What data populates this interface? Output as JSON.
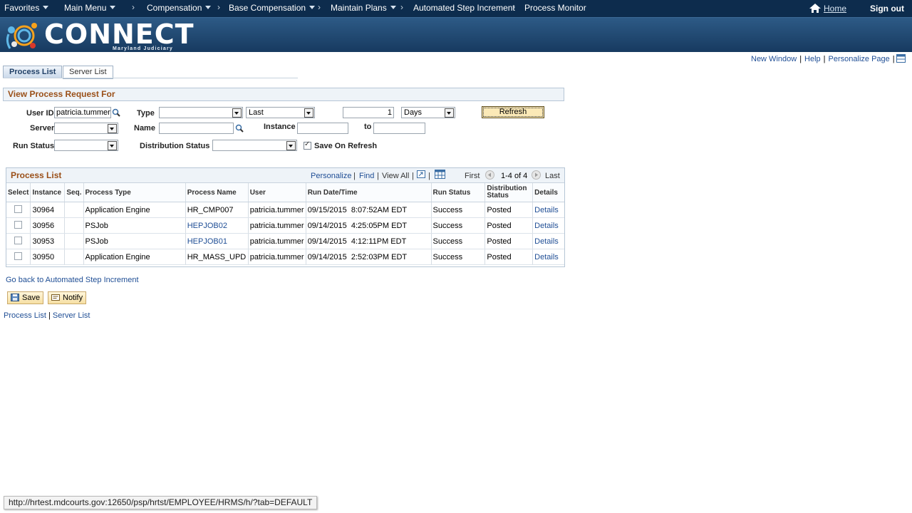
{
  "topnav": {
    "favorites": "Favorites",
    "main_menu": "Main Menu",
    "crumbs": [
      "Compensation",
      "Base Compensation",
      "Maintain Plans",
      "Automated Step Increment",
      "Process Monitor"
    ],
    "home": "Home",
    "sign_out": "Sign out"
  },
  "banner": {
    "logo_text": "CONNECT",
    "logo_sub": "Maryland Judiciary"
  },
  "utility": {
    "new_window": "New Window",
    "help": "Help",
    "personalize_page": "Personalize Page",
    "separator": "|"
  },
  "tabs": {
    "process_list": "Process List",
    "server_list": "Server List"
  },
  "filters": {
    "title": "View Process Request For",
    "user_id_label": "User ID",
    "user_id_value": "patricia.tummer",
    "type_label": "Type",
    "type_value": "",
    "last_value": "Last",
    "count_value": "1",
    "unit_value": "Days",
    "refresh_label": "Refresh",
    "server_label": "Server",
    "server_value": "",
    "name_label": "Name",
    "name_value": "",
    "instance_label": "Instance",
    "instance_from": "",
    "to_label": "to",
    "instance_to": "",
    "run_status_label": "Run Status",
    "run_status_value": "",
    "dist_status_label": "Distribution Status",
    "dist_status_value": "",
    "save_on_refresh_label": "Save On Refresh",
    "save_on_refresh_checked": true
  },
  "process_list": {
    "title": "Process List",
    "personalize": "Personalize",
    "find": "Find",
    "view_all": "View All",
    "bar": "|",
    "first": "First",
    "range": "1-4 of 4",
    "last": "Last",
    "columns": {
      "select": "Select",
      "instance": "Instance",
      "seq": "Seq.",
      "process_type": "Process Type",
      "process_name": "Process Name",
      "user": "User",
      "run_datetime": "Run Date/Time",
      "run_status": "Run Status",
      "distribution_status": "Distribution Status",
      "details": "Details"
    },
    "rows": [
      {
        "instance": "30964",
        "seq": "",
        "process_type": "Application Engine",
        "process_name": "HR_CMP007",
        "process_name_link": false,
        "user": "patricia.tummer",
        "run_datetime": "09/15/2015  8:07:52AM EDT",
        "run_status": "Success",
        "distribution_status": "Posted",
        "details": "Details"
      },
      {
        "instance": "30956",
        "seq": "",
        "process_type": "PSJob",
        "process_name": "HEPJOB02",
        "process_name_link": true,
        "user": "patricia.tummer",
        "run_datetime": "09/14/2015  4:25:05PM EDT",
        "run_status": "Success",
        "distribution_status": "Posted",
        "details": "Details"
      },
      {
        "instance": "30953",
        "seq": "",
        "process_type": "PSJob",
        "process_name": "HEPJOB01",
        "process_name_link": true,
        "user": "patricia.tummer",
        "run_datetime": "09/14/2015  4:12:11PM EDT",
        "run_status": "Success",
        "distribution_status": "Posted",
        "details": "Details"
      },
      {
        "instance": "30950",
        "seq": "",
        "process_type": "Application Engine",
        "process_name": "HR_MASS_UPD",
        "process_name_link": false,
        "user": "patricia.tummer",
        "run_datetime": "09/14/2015  2:52:03PM EDT",
        "run_status": "Success",
        "distribution_status": "Posted",
        "details": "Details"
      }
    ]
  },
  "footer": {
    "go_back": "Go back to Automated Step Increment",
    "save": "Save",
    "notify": "Notify",
    "process_list_link": "Process List",
    "server_list_link": "Server List",
    "separator": "|"
  },
  "status_bar": {
    "url": "http://hrtest.mdcourts.gov:12650/psp/hrtst/EMPLOYEE/HRMS/h/?tab=DEFAULT"
  },
  "colors": {
    "nav_bg": "#0d2c4d",
    "section_title": "#9a4f18",
    "link": "#1f4e95",
    "button_bg": "#fbe9b7"
  }
}
